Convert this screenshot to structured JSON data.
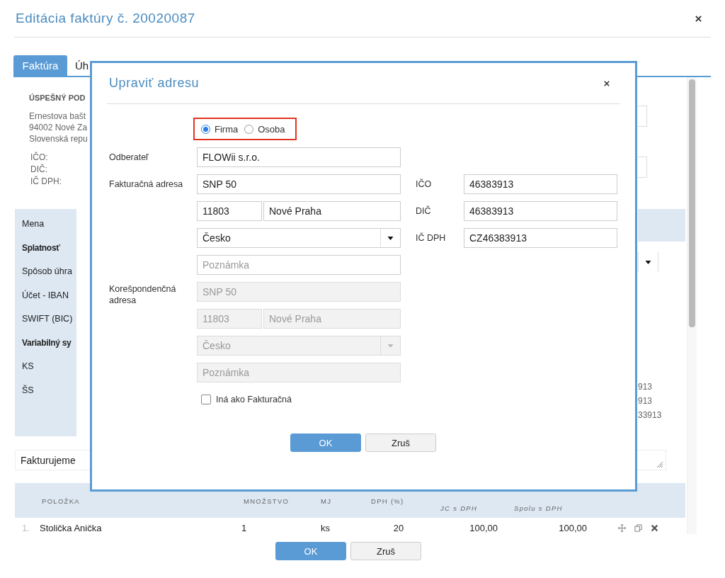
{
  "window": {
    "title": "Editácia faktúry č. 20020087"
  },
  "tabs": [
    {
      "label": "Faktúra",
      "selected": true
    },
    {
      "label": "Úh",
      "selected": false
    }
  ],
  "seller": {
    "name": "ÚSPEŠNÝ POD",
    "address": [
      "Ernestova bašt",
      "94002 Nové Za",
      "Slovenská repu"
    ],
    "ids": [
      "IČO:",
      "DIČ:",
      "IČ DPH:"
    ]
  },
  "details": {
    "labels": [
      {
        "text": "Mena",
        "bold": false
      },
      {
        "text": "Splatnosť",
        "bold": true
      },
      {
        "text": "Spôsob úhra",
        "bold": false
      },
      {
        "text": "Účet - IBAN",
        "bold": false
      },
      {
        "text": "SWIFT (BIC)",
        "bold": false
      },
      {
        "text": "Variabilný sy",
        "bold": true
      },
      {
        "text": "KS",
        "bold": false
      },
      {
        "text": "ŠS",
        "bold": false
      }
    ],
    "id_values": [
      "913",
      "913",
      "33913"
    ]
  },
  "note_field": {
    "value": "Fakturujeme"
  },
  "table": {
    "columns": [
      {
        "label": "POLOŽKA",
        "italic": false
      },
      {
        "label": "MNOŽSTVO",
        "italic": false
      },
      {
        "label": "MJ",
        "italic": false
      },
      {
        "label": "DPH (%)",
        "italic": false
      },
      {
        "label": "JC s DPH",
        "italic": true
      },
      {
        "label": "Spolu s DPH",
        "italic": true
      }
    ],
    "rows": [
      {
        "index": "1.",
        "cells": [
          "Stolička Anička",
          "1",
          "ks",
          "20",
          "100,00",
          "100,00"
        ]
      }
    ]
  },
  "buttons": [
    "OK",
    "Zruš"
  ],
  "dialog": {
    "title": "Upraviť adresu",
    "entity_types": [
      {
        "label": "Firma",
        "selected": true
      },
      {
        "label": "Osoba",
        "selected": false
      }
    ],
    "customer": {
      "label": "Odberateľ",
      "value": "FLOWii s.r.o."
    },
    "billing": {
      "label": "Fakturačná adresa",
      "street": "SNP 50",
      "zip": "11803",
      "city": "Nové Praha",
      "country": "Česko",
      "note_placeholder": "Poznámka",
      "disabled": false
    },
    "ids": [
      {
        "label": "IČO",
        "value": "46383913"
      },
      {
        "label": "DIČ",
        "value": "46383913"
      },
      {
        "label": "IČ DPH",
        "value": "CZ46383913"
      }
    ],
    "correspondence": {
      "label": "Korešpondenčná adresa",
      "street": "SNP 50",
      "zip": "11803",
      "city": "Nové Praha",
      "country": "Česko",
      "note_placeholder": "Poznámka",
      "disabled": true
    },
    "different_checkbox": {
      "label": "Iná ako Fakturačná",
      "checked": false
    },
    "buttons": [
      "OK",
      "Zruš"
    ]
  }
}
